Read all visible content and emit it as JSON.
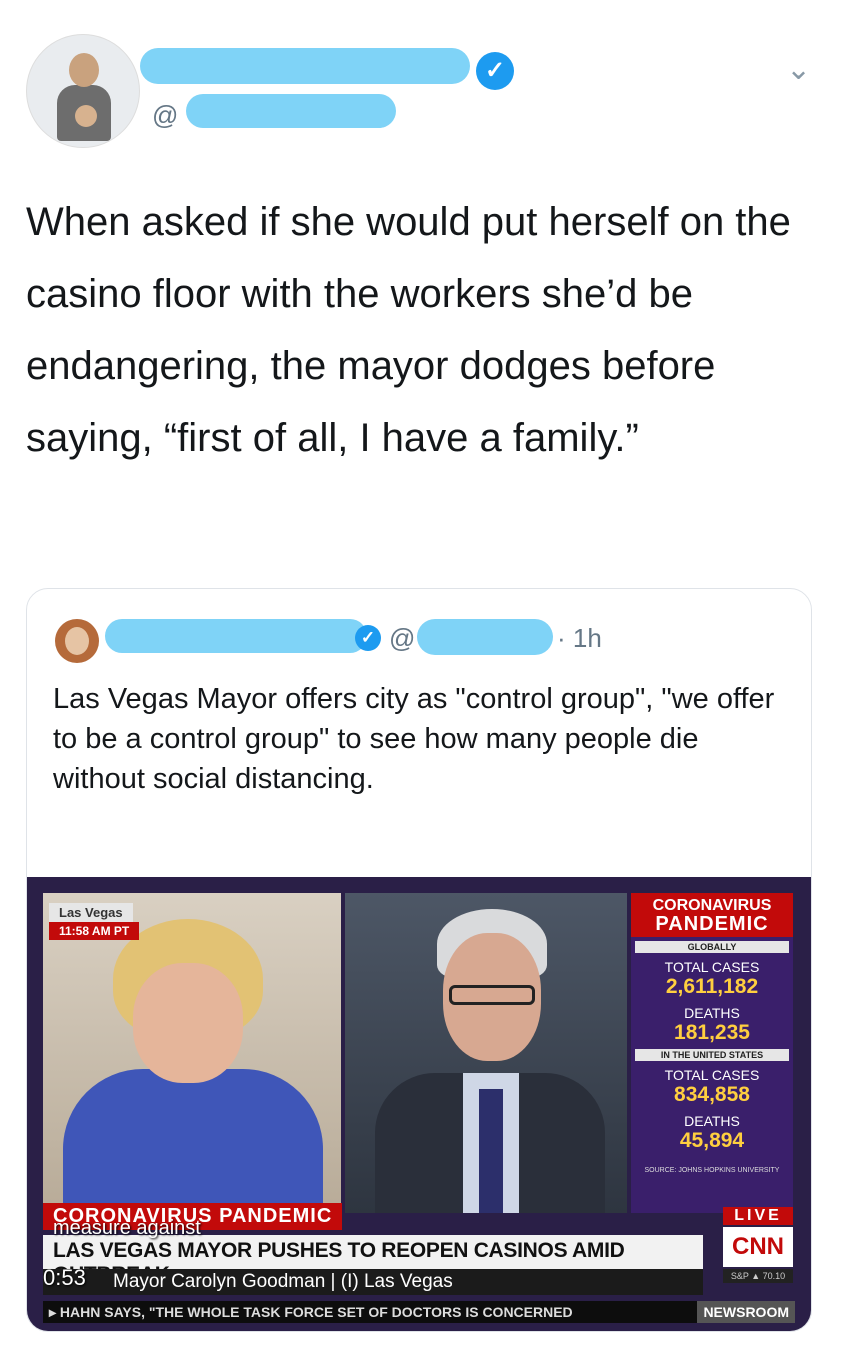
{
  "header": {
    "handle_prefix": "@"
  },
  "tweet": {
    "text": "When asked if she would put herself on the casino floor with the workers she’d be endangering, the mayor dodges before saying, “first of all, I have a family.”"
  },
  "quote": {
    "handle_prefix": "@",
    "time": "· 1h",
    "text": "Las Vegas Mayor offers city as \"control group\", \"we offer to be a control group\" to see how many people die without social distancing."
  },
  "video": {
    "location": "Las Vegas",
    "local_time": "11:58 AM PT",
    "stats": {
      "title_line1": "CORONAVIRUS",
      "title_line2": "PANDEMIC",
      "globally": "GLOBALLY",
      "total_cases_label": "TOTAL CASES",
      "global_cases": "2,611,182",
      "deaths_label": "DEATHS",
      "global_deaths": "181,235",
      "us_label": "IN THE UNITED STATES",
      "us_cases_label": "TOTAL CASES",
      "us_cases": "834,858",
      "us_deaths_label": "DEATHS",
      "us_deaths": "45,894",
      "source": "SOURCE: JOHNS HOPKINS UNIVERSITY"
    },
    "topic": "CORONAVIRUS PANDEMIC",
    "caption": "measure against",
    "headline": "LAS VEGAS MAYOR PUSHES TO REOPEN CASINOS AMID OUTBREAK",
    "subline": "Mayor Carolyn Goodman | (I) Las Vegas",
    "timer": "0:53",
    "live": "LIVE",
    "network": "CNN",
    "market": "S&P ▲ 70.10",
    "ticker": "▸ HAHN SAYS, \"THE WHOLE TASK FORCE SET OF DOCTORS IS CONCERNED",
    "show": "NEWSROOM"
  }
}
